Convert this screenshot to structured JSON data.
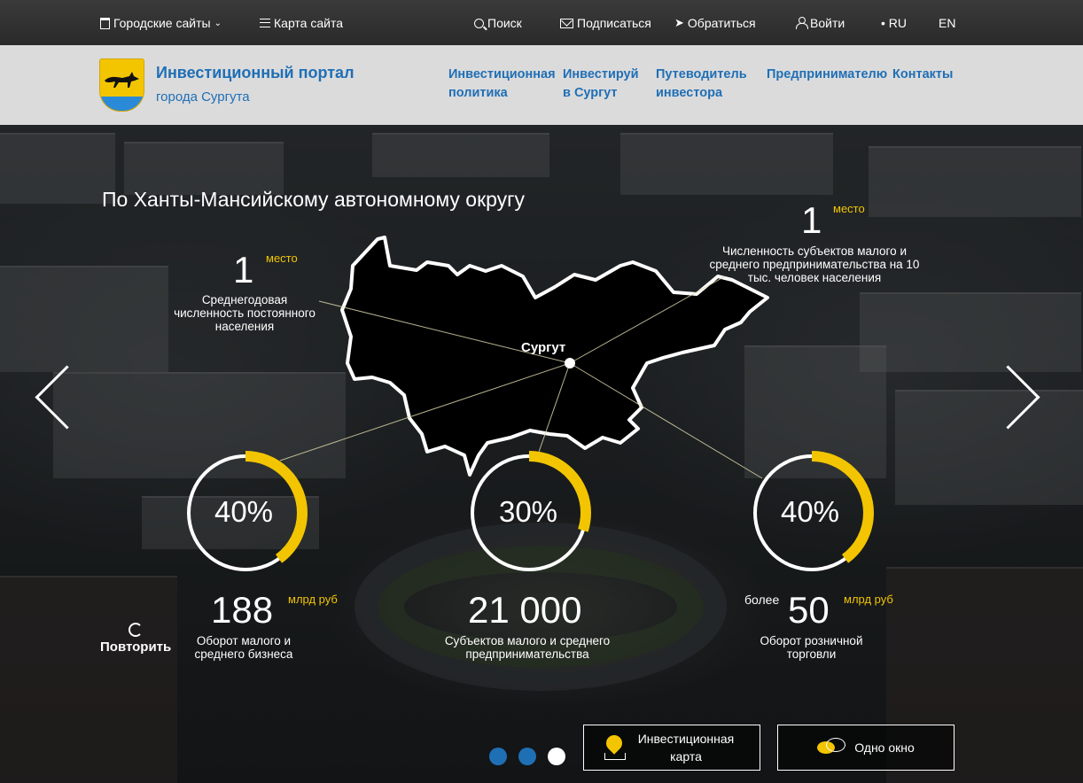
{
  "topbar": {
    "city_sites": "Городские сайты",
    "sitemap": "Карта сайта",
    "search": "Поиск",
    "subscribe": "Подписаться",
    "contact_us": "Обратиться",
    "login": "Войти",
    "lang_ru": "• RU",
    "lang_en": "EN"
  },
  "header": {
    "title": "Инвестиционный портал",
    "subtitle": "города Сургута",
    "nav": [
      {
        "label": "Инвестиционная политика"
      },
      {
        "label": "Инвестируй в Сургут"
      },
      {
        "label": "Путеводитель инвестора"
      },
      {
        "label": "Предпринимателю"
      },
      {
        "label": "Контакты"
      }
    ]
  },
  "hero": {
    "title": "По Ханты-Мансийскому автономному округу",
    "map_city": "Сургут",
    "rank_left": {
      "value": "1",
      "unit": "место",
      "desc": "Среднегодовая численность постоянного населения"
    },
    "rank_right": {
      "value": "1",
      "unit": "место",
      "desc": "Численность субъектов малого и среднего предпринимательства на 10 тыс. человек населения"
    },
    "rings": [
      {
        "label": "40%",
        "percent": 40
      },
      {
        "label": "30%",
        "percent": 30
      },
      {
        "label": "40%",
        "percent": 40
      }
    ],
    "stats": [
      {
        "prefix": "",
        "value": "188",
        "unit": "млрд руб",
        "desc": "Оборот малого и среднего бизнеса"
      },
      {
        "prefix": "",
        "value": "21 000",
        "unit": "",
        "desc": "Субъектов малого и среднего предпринимательства"
      },
      {
        "prefix": "более",
        "value": "50",
        "unit": "млрд руб",
        "desc": "Оборот розничной торговли"
      }
    ],
    "replay": "Повторить"
  },
  "slider": {
    "active_index": 2,
    "dots": 3
  },
  "cta": {
    "invest_map": "Инвестиционная карта",
    "one_window": "Одно окно"
  },
  "colors": {
    "brand_blue": "#1f6fb5",
    "accent_yellow": "#f2c500",
    "dot_inactive": "#1f6fb5",
    "dot_active": "#ffffff"
  }
}
